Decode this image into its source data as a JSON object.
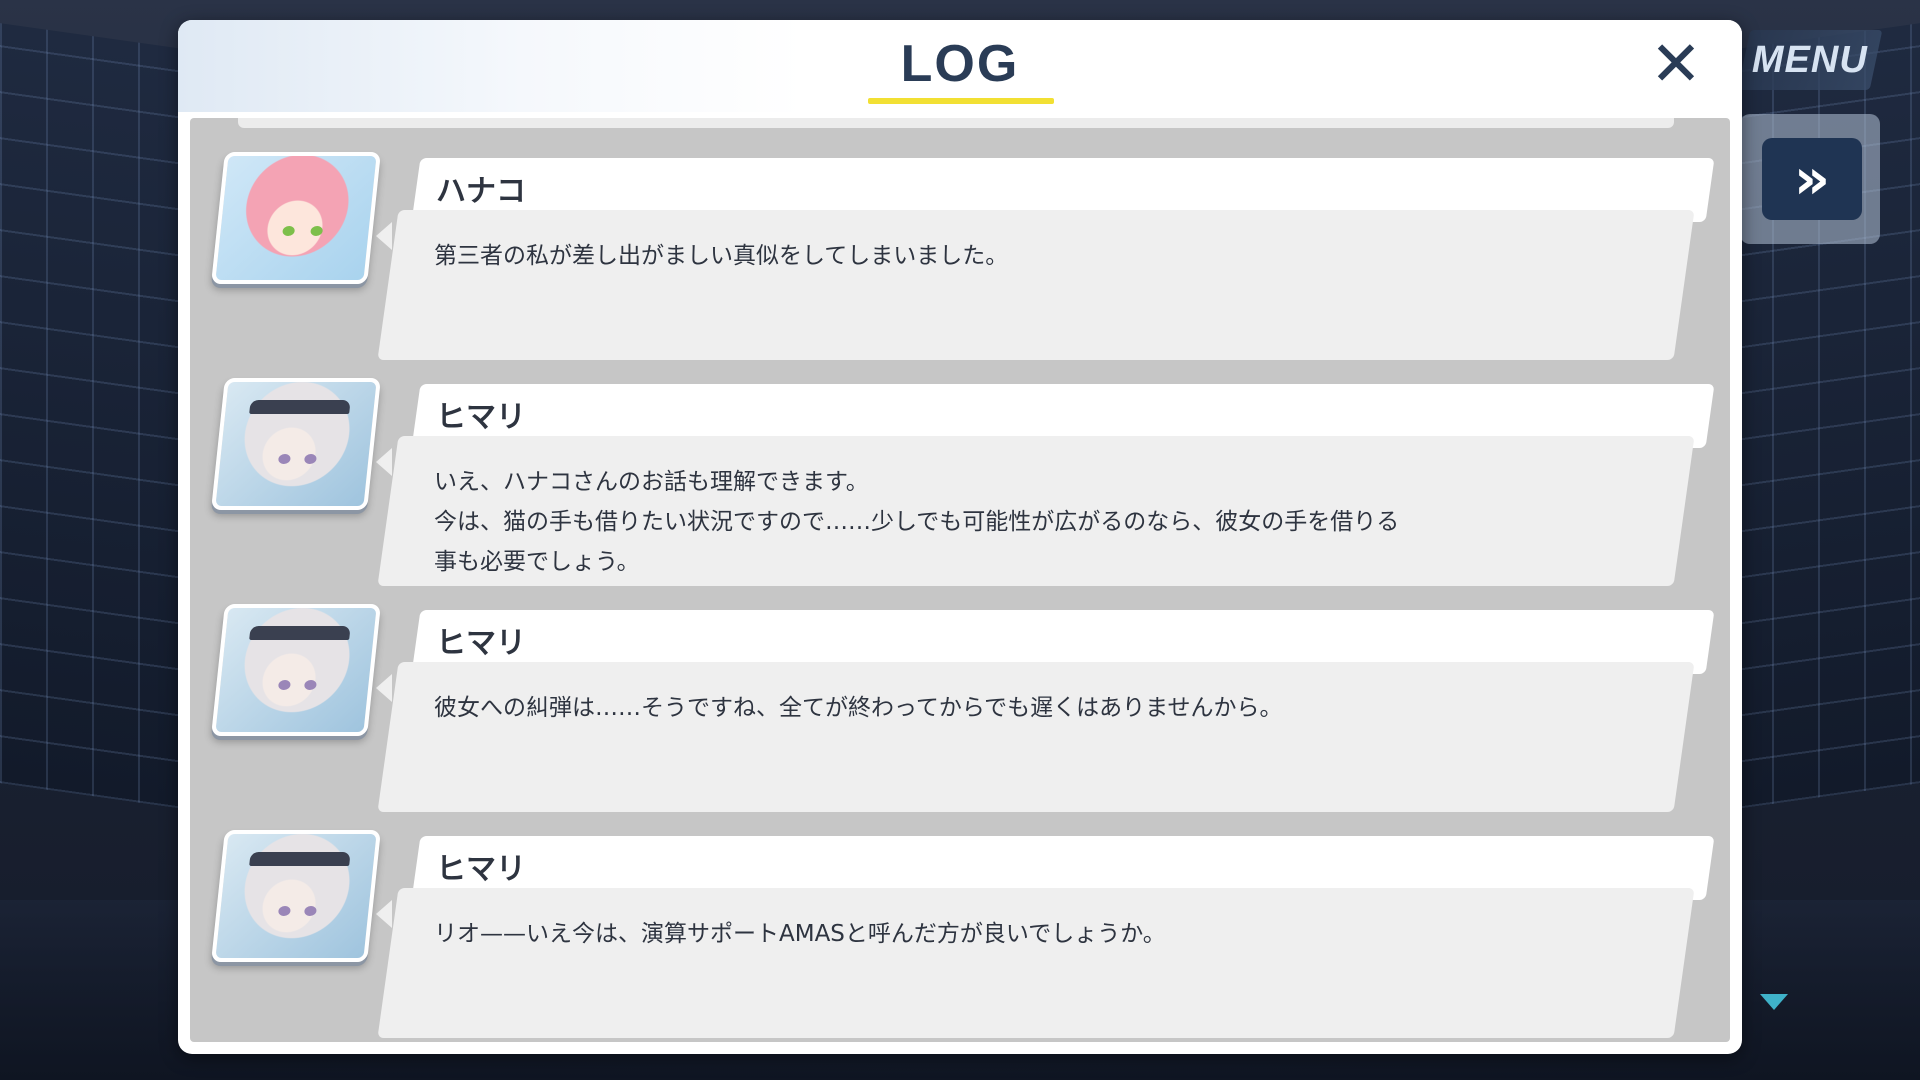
{
  "dialog": {
    "title": "LOG",
    "close_label": "✕"
  },
  "menu": {
    "label": "MENU",
    "fast_forward_label": "»"
  },
  "entries": [
    {
      "speaker": "ハナコ",
      "avatar": "hanako-portrait",
      "lines": [
        "第三者の私が差し出がましい真似をしてしまいました。"
      ]
    },
    {
      "speaker": "ヒマリ",
      "avatar": "himari-portrait",
      "lines": [
        "いえ、ハナコさんのお話も理解できます。",
        "今は、猫の手も借りたい状況ですので……少しでも可能性が広がるのなら、彼女の手を借りる",
        "事も必要でしょう。"
      ]
    },
    {
      "speaker": "ヒマリ",
      "avatar": "himari-portrait",
      "lines": [
        "彼女への糾弾は……そうですね、全てが終わってからでも遅くはありませんから。"
      ]
    },
    {
      "speaker": "ヒマリ",
      "avatar": "himari-portrait",
      "lines": [
        "リオ——いえ今は、演算サポートAMASと呼んだ方が良いでしょうか。"
      ]
    }
  ],
  "colors": {
    "title": "#2a3c56",
    "underline": "#f2e033",
    "log_background": "#c6c6c6",
    "bubble_body": "#efefef",
    "scroll_arrow": "#3fb2c9"
  }
}
